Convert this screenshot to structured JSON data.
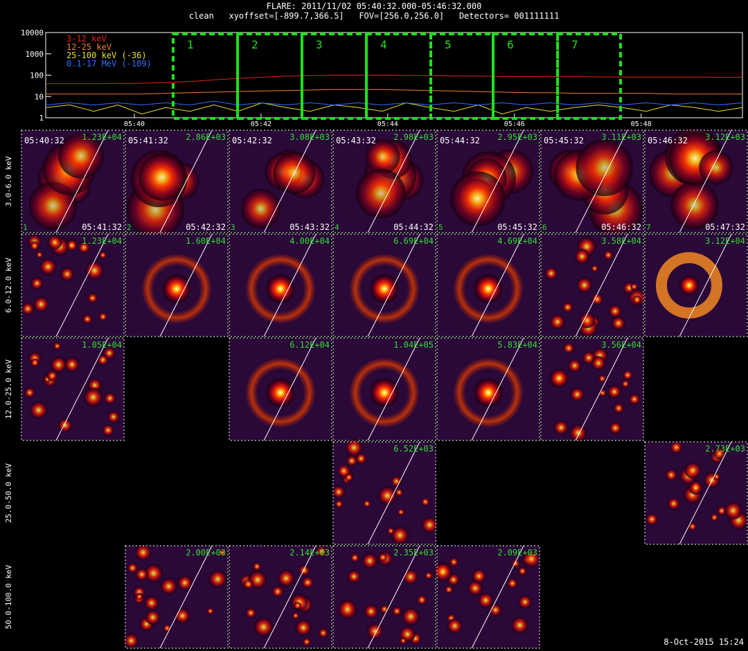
{
  "header": {
    "title": "FLARE: 2011/11/02 05:40:32.000-05:46:32.000",
    "subtitle": "clean   xyoffset=[-899.7,366.5]   FOV=[256.0,256.0]   Detectors= 001111111"
  },
  "chart_data": [
    {
      "type": "line",
      "name": "lightcurve",
      "yscale": "log",
      "ylim": [
        1,
        10000
      ],
      "y_ticks": [
        "1",
        "10",
        "100",
        "1000",
        "10000"
      ],
      "x_ticks": [
        "05:40",
        "05:42",
        "05:44",
        "05:46",
        "05:48"
      ],
      "xlim_minutes": [
        38.6,
        49.6
      ],
      "series": [
        {
          "name": "3-12 keV",
          "color": "#e8201c",
          "values": [
            40,
            40,
            40,
            41,
            42,
            45,
            50,
            60,
            70,
            80,
            90,
            95,
            100,
            100,
            100,
            98,
            95,
            92,
            90,
            88,
            86,
            85,
            84,
            83,
            82,
            82,
            81,
            81,
            80,
            80
          ]
        },
        {
          "name": "12-25 keV",
          "color": "#f08030",
          "values": [
            13,
            13,
            13,
            13,
            13,
            14,
            15,
            16,
            17,
            18,
            19,
            20,
            21,
            21,
            21,
            20,
            19,
            18,
            17,
            16,
            15,
            15,
            14,
            14,
            14,
            14,
            13,
            13,
            13,
            13
          ]
        },
        {
          "name": "25-100 keV (-36)",
          "color": "#e8e020",
          "values": [
            3,
            4,
            2,
            4,
            1.5,
            3,
            2,
            4,
            2,
            5,
            3,
            2,
            4,
            3,
            2,
            5,
            3,
            2,
            4,
            1.5,
            3,
            2,
            3,
            4,
            3,
            2,
            4,
            3,
            2,
            3
          ]
        },
        {
          "name": "0.1-17 MeV (-109)",
          "color": "#3070ff",
          "values": [
            4,
            5,
            4,
            5,
            4,
            5,
            4,
            6,
            4,
            5,
            4,
            5,
            4,
            5,
            4,
            5,
            4,
            5,
            4,
            5,
            4,
            5,
            4,
            5,
            4,
            5,
            4,
            5,
            4,
            5
          ]
        }
      ],
      "intervals": [
        "1",
        "2",
        "3",
        "4",
        "5",
        "6",
        "7"
      ],
      "interval_color": "#20e020"
    },
    {
      "type": "heatmap",
      "name": "image-grid",
      "rows": [
        "3.0-6.0 keV",
        "6.0-12.0 keV",
        "12.0-25.0 keV",
        "25.0-50.0 keV",
        "50.0-100.0 keV"
      ],
      "panels": [
        {
          "row": 0,
          "col": 0,
          "max": "1.23E+04",
          "t1": "05:40:32",
          "t2": "05:41:32",
          "idx": "1"
        },
        {
          "row": 0,
          "col": 1,
          "max": "2.86E+03",
          "t1": "05:41:32",
          "t2": "05:42:32",
          "idx": "2"
        },
        {
          "row": 0,
          "col": 2,
          "max": "3.08E+03",
          "t1": "05:42:32",
          "t2": "05:43:32",
          "idx": "3"
        },
        {
          "row": 0,
          "col": 3,
          "max": "2.98E+03",
          "t1": "05:43:32",
          "t2": "05:44:32",
          "idx": "4"
        },
        {
          "row": 0,
          "col": 4,
          "max": "2.95E+03",
          "t1": "05:44:32",
          "t2": "05:45:32",
          "idx": "5"
        },
        {
          "row": 0,
          "col": 5,
          "max": "3.11E+03",
          "t1": "05:45:32",
          "t2": "05:46:32",
          "idx": "6"
        },
        {
          "row": 0,
          "col": 6,
          "max": "3.12E+03",
          "t1": "05:46:32",
          "t2": "05:47:32",
          "idx": "7"
        },
        {
          "row": 1,
          "col": 0,
          "max": "1.23E+04"
        },
        {
          "row": 1,
          "col": 1,
          "max": "1.60E+04"
        },
        {
          "row": 1,
          "col": 2,
          "max": "4.00E+04"
        },
        {
          "row": 1,
          "col": 3,
          "max": "6.69E+04"
        },
        {
          "row": 1,
          "col": 4,
          "max": "4.69E+04"
        },
        {
          "row": 1,
          "col": 5,
          "max": "3.58E+04"
        },
        {
          "row": 1,
          "col": 6,
          "max": "3.12E+04"
        },
        {
          "row": 2,
          "col": 0,
          "max": "1.05E+04"
        },
        {
          "row": 2,
          "col": 2,
          "max": "6.12E+04"
        },
        {
          "row": 2,
          "col": 3,
          "max": "1.04E+05"
        },
        {
          "row": 2,
          "col": 4,
          "max": "5.83E+04"
        },
        {
          "row": 2,
          "col": 5,
          "max": "3.56E+04"
        },
        {
          "row": 3,
          "col": 3,
          "max": "6.52E+03"
        },
        {
          "row": 3,
          "col": 6,
          "max": "2.73E+03"
        },
        {
          "row": 4,
          "col": 1,
          "max": "2.00E+03"
        },
        {
          "row": 4,
          "col": 2,
          "max": "2.14E+03"
        },
        {
          "row": 4,
          "col": 3,
          "max": "2.35E+03"
        },
        {
          "row": 4,
          "col": 4,
          "max": "2.09E+03"
        }
      ]
    }
  ],
  "footer": {
    "stamp": "8-Oct-2015 15:24"
  }
}
